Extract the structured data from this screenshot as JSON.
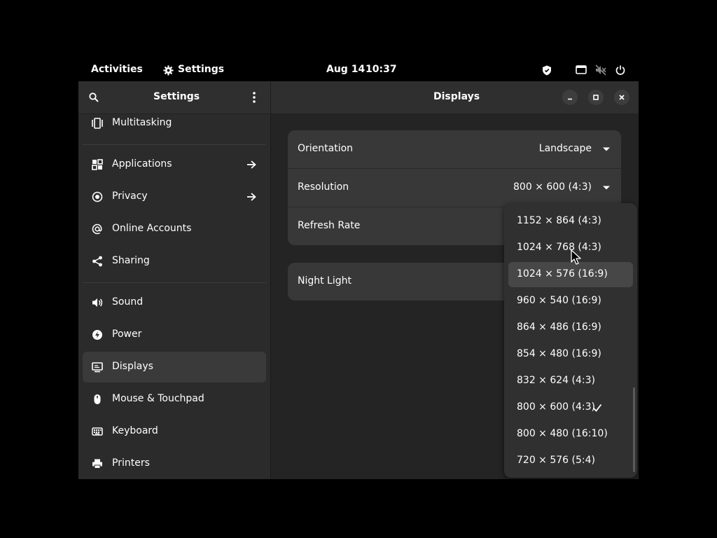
{
  "topbar": {
    "activities": "Activities",
    "app_name": "Settings",
    "date": "Aug 14",
    "time": "10:37"
  },
  "sidebar": {
    "title": "Settings",
    "items": [
      {
        "label": "Multitasking",
        "icon": "multitasking-icon"
      },
      {
        "label": "Applications",
        "icon": "applications-icon"
      },
      {
        "label": "Privacy",
        "icon": "privacy-icon"
      },
      {
        "label": "Online Accounts",
        "icon": "online-accounts-icon"
      },
      {
        "label": "Sharing",
        "icon": "sharing-icon"
      },
      {
        "label": "Sound",
        "icon": "sound-icon"
      },
      {
        "label": "Power",
        "icon": "power-icon"
      },
      {
        "label": "Displays",
        "icon": "displays-icon"
      },
      {
        "label": "Mouse & Touchpad",
        "icon": "mouse-icon"
      },
      {
        "label": "Keyboard",
        "icon": "keyboard-icon"
      },
      {
        "label": "Printers",
        "icon": "printer-icon"
      }
    ],
    "active": "Displays"
  },
  "main": {
    "title": "Displays",
    "rows": {
      "orientation": {
        "label": "Orientation",
        "value": "Landscape"
      },
      "resolution": {
        "label": "Resolution",
        "value": "800 × 600 (4:3)"
      },
      "refresh_rate": {
        "label": "Refresh Rate",
        "value": ""
      },
      "night_light": {
        "label": "Night Light"
      }
    }
  },
  "resolution_menu": {
    "options": [
      "1152 × 864 (4:3)",
      "1024 × 768 (4:3)",
      "1024 × 576 (16:9)",
      "960 × 540 (16:9)",
      "864 × 486 (16:9)",
      "854 × 480 (16:9)",
      "832 × 624 (4:3)",
      "800 × 600 (4:3)",
      "800 × 480 (16:10)",
      "720 × 576 (5:4)"
    ],
    "selected": "800 × 600 (4:3)",
    "hovered": "1024 × 576 (16:9)"
  },
  "colors": {
    "sidebar_bg": "#2b2b2b",
    "content_bg": "#242424",
    "card_bg": "#383838",
    "popover_bg": "#303030",
    "active_item": "#3a3a3a"
  }
}
